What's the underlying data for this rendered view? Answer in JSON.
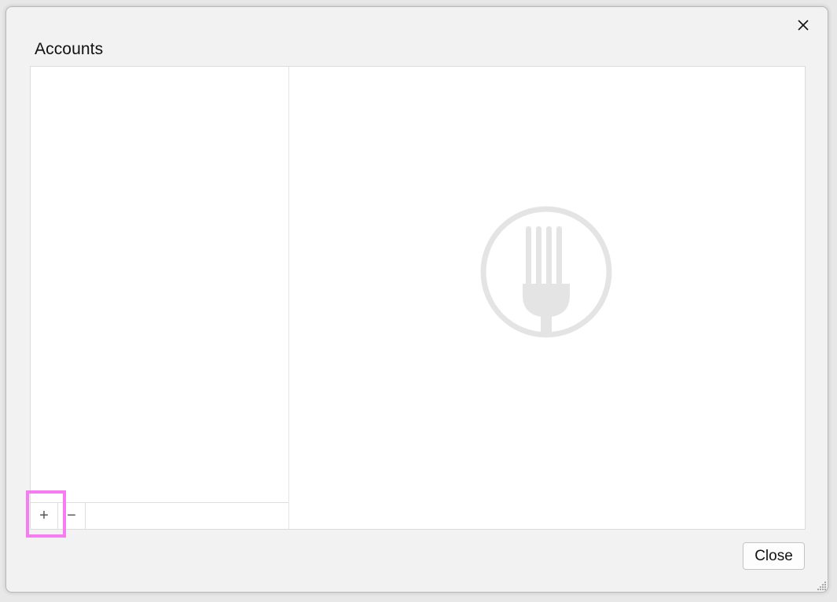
{
  "dialog": {
    "title": "Accounts",
    "close_icon": "close-icon"
  },
  "list_toolbar": {
    "add_label": "+",
    "remove_label": "−",
    "add_icon": "plus-icon",
    "remove_icon": "minus-icon"
  },
  "detail": {
    "placeholder_icon": "fork-icon"
  },
  "footer": {
    "close_label": "Close"
  },
  "colors": {
    "highlight": "#f77cf2",
    "placeholder_icon": "#e4e4e4"
  }
}
